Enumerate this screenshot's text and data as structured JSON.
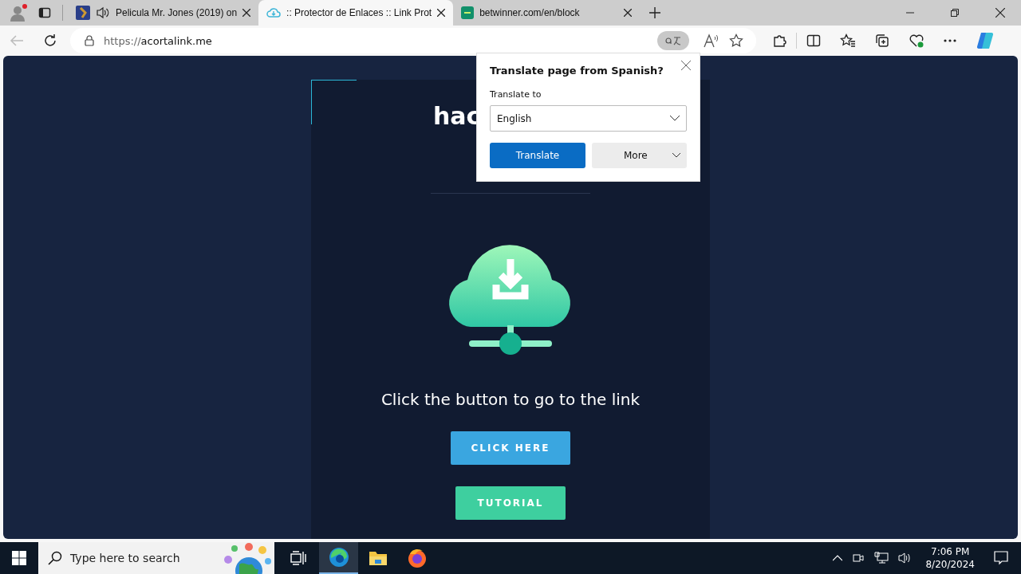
{
  "tabs": [
    {
      "kind": "image",
      "title": "Pelicula Mr. Jones (2019) on",
      "audio": true,
      "selected": false
    },
    {
      "kind": "cloud",
      "title": ":: Protector de Enlaces :: Link Prot",
      "audio": false,
      "selected": true
    },
    {
      "kind": "badge",
      "title": "betwinner.com/en/block",
      "audio": false,
      "selected": false
    }
  ],
  "address_bar": {
    "scheme": "https://",
    "host": "acortalink.me"
  },
  "page": {
    "heading": "hac",
    "message": "Click the button to go to the link",
    "buttons": [
      {
        "kind": "primary",
        "label": "CLICK HERE"
      },
      {
        "kind": "secondary",
        "label": "TUTORIAL"
      }
    ]
  },
  "translate_popup": {
    "title": "Translate page from Spanish?",
    "label": "Translate to",
    "language": "English",
    "translate_button": "Translate",
    "more_button": "More"
  },
  "taskbar": {
    "search_placeholder": "Type here to search",
    "apps": [
      {
        "kind": "edge",
        "selected": true
      },
      {
        "kind": "folder",
        "selected": false
      },
      {
        "kind": "firefox",
        "selected": false
      }
    ],
    "time": "7:06 PM",
    "date": "8/20/2024"
  }
}
